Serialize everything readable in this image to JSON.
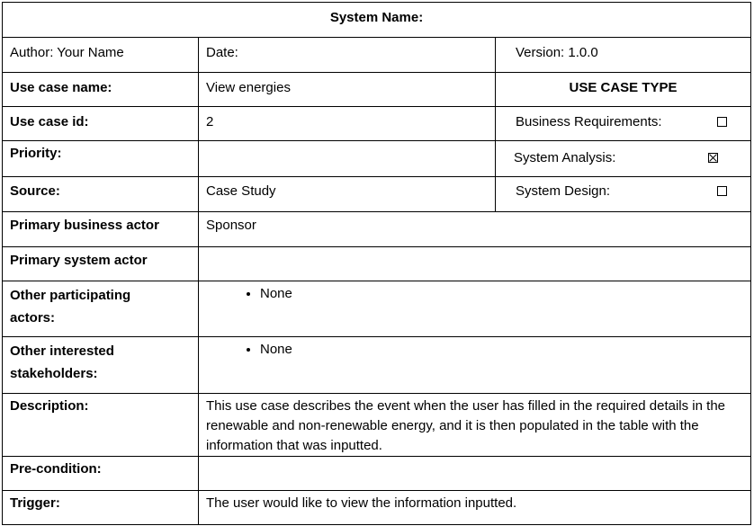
{
  "header": {
    "system_name_label": "System Name:"
  },
  "row_author": {
    "author": "Author: Your Name",
    "date": "Date:",
    "version": "Version: 1.0.0"
  },
  "row_uc_name": {
    "label": "Use case name:",
    "value": "View energies",
    "type_heading": "USE CASE TYPE"
  },
  "row_uc_id": {
    "label": "Use case id:",
    "value": "2",
    "type_option": "Business Requirements:",
    "checked": false
  },
  "row_priority": {
    "label": "Priority:",
    "value": "",
    "type_option": "System Analysis:",
    "checked": true
  },
  "row_source": {
    "label": "Source:",
    "value": "Case Study",
    "type_option": "System Design:",
    "checked": false
  },
  "row_business_actor": {
    "label": "Primary business actor",
    "value": "Sponsor"
  },
  "row_system_actor": {
    "label": "Primary system actor",
    "value": ""
  },
  "row_other_actors": {
    "label": "Other participating actors:",
    "items": [
      "None"
    ]
  },
  "row_stakeholders": {
    "label": "Other interested stakeholders:",
    "items": [
      "None"
    ]
  },
  "row_description": {
    "label": "Description:",
    "value": "This use case describes the event when the user has filled in the required details in the renewable and non-renewable energy, and it is then populated in the table with the information that was inputted."
  },
  "row_precondition": {
    "label": "Pre-condition:",
    "value": ""
  },
  "row_trigger": {
    "label": "Trigger:",
    "value": "The user would like to view the information inputted."
  }
}
